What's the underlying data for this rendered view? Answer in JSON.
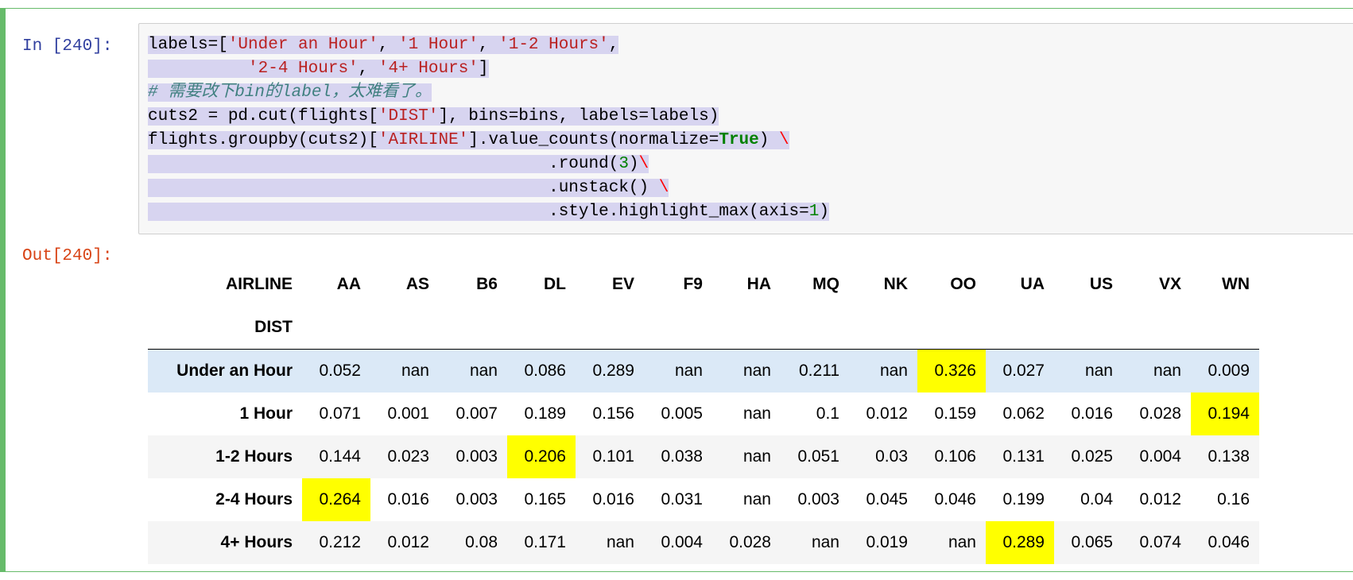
{
  "input_prompt": "In [240]:",
  "output_prompt": "Out[240]:",
  "code_lines": [
    [
      "labels=[",
      "'Under an Hour'",
      ", ",
      "'1 Hour'",
      ", ",
      "'1-2 Hours'",
      ","
    ],
    [
      "          ",
      "'2-4 Hours'",
      ", ",
      "'4+ Hours'",
      "]"
    ]
  ],
  "code": {
    "line1": "labels=[",
    "s1": "'Under an Hour'",
    "s2": "'1 Hour'",
    "s3": "'1-2 Hours'",
    "s4": "'2-4 Hours'",
    "s5": "'4+ Hours'",
    "comment": "# 需要改下bin的label，太难看了。",
    "cuts_a": "cuts2 = pd.cut(flights[",
    "dist": "'DIST'",
    "cuts_b": "], bins=bins, labels=labels)",
    "gb_a": "flights.groupby(cuts2)[",
    "airline": "'AIRLINE'",
    "gb_b": "].value_counts(normalize=",
    "true": "True",
    "gb_c": ") ",
    "bs": "\\",
    "round_a": ".round(",
    "three": "3",
    "round_b": ")",
    "unstack": ".unstack() ",
    "style_a": ".style.highlight_max(axis=",
    "one": "1",
    "style_b": ")"
  },
  "table": {
    "index_header": "AIRLINE",
    "row_header": "DIST",
    "columns": [
      "AA",
      "AS",
      "B6",
      "DL",
      "EV",
      "F9",
      "HA",
      "MQ",
      "NK",
      "OO",
      "UA",
      "US",
      "VX",
      "WN"
    ],
    "rows": [
      {
        "label": "Under an Hour",
        "values": [
          "0.052",
          "nan",
          "nan",
          "0.086",
          "0.289",
          "nan",
          "nan",
          "0.211",
          "nan",
          "0.326",
          "0.027",
          "nan",
          "nan",
          "0.009"
        ],
        "max_index": 9
      },
      {
        "label": "1 Hour",
        "values": [
          "0.071",
          "0.001",
          "0.007",
          "0.189",
          "0.156",
          "0.005",
          "nan",
          "0.1",
          "0.012",
          "0.159",
          "0.062",
          "0.016",
          "0.028",
          "0.194"
        ],
        "max_index": 13
      },
      {
        "label": "1-2 Hours",
        "values": [
          "0.144",
          "0.023",
          "0.003",
          "0.206",
          "0.101",
          "0.038",
          "nan",
          "0.051",
          "0.03",
          "0.106",
          "0.131",
          "0.025",
          "0.004",
          "0.138"
        ],
        "max_index": 3
      },
      {
        "label": "2-4 Hours",
        "values": [
          "0.264",
          "0.016",
          "0.003",
          "0.165",
          "0.016",
          "0.031",
          "nan",
          "0.003",
          "0.045",
          "0.046",
          "0.199",
          "0.04",
          "0.012",
          "0.16"
        ],
        "max_index": 0
      },
      {
        "label": "4+ Hours",
        "values": [
          "0.212",
          "0.012",
          "0.08",
          "0.171",
          "nan",
          "0.004",
          "0.028",
          "nan",
          "0.019",
          "nan",
          "0.289",
          "0.065",
          "0.074",
          "0.046"
        ],
        "max_index": 10
      }
    ]
  },
  "colors": {
    "highlight": "#ffff00",
    "cell_border": "#66bb6a",
    "input_prompt": "#303f9f",
    "output_prompt": "#d84315"
  }
}
